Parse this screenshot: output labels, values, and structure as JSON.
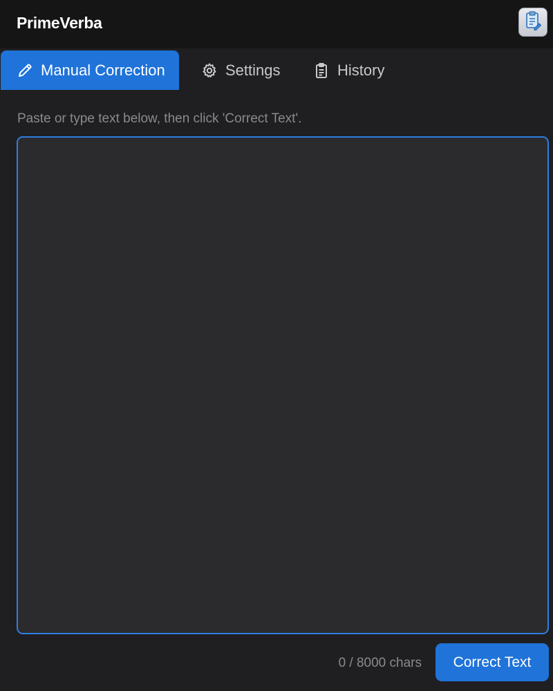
{
  "header": {
    "title": "PrimeVerba",
    "action_icon": "clipboard-icon"
  },
  "tabs": [
    {
      "label": "Manual Correction",
      "icon": "pencil-icon",
      "active": true
    },
    {
      "label": "Settings",
      "icon": "gear-icon",
      "active": false
    },
    {
      "label": "History",
      "icon": "clipboard-list-icon",
      "active": false
    }
  ],
  "main": {
    "instruction": "Paste or type text below, then click 'Correct Text'.",
    "editor_value": "",
    "editor_placeholder": "",
    "char_count": "0 / 8000 chars",
    "submit_label": "Correct Text"
  },
  "colors": {
    "accent": "#1f73d9",
    "background": "#1f1f21",
    "header_background": "#151516",
    "editor_background": "#2b2b2e"
  }
}
